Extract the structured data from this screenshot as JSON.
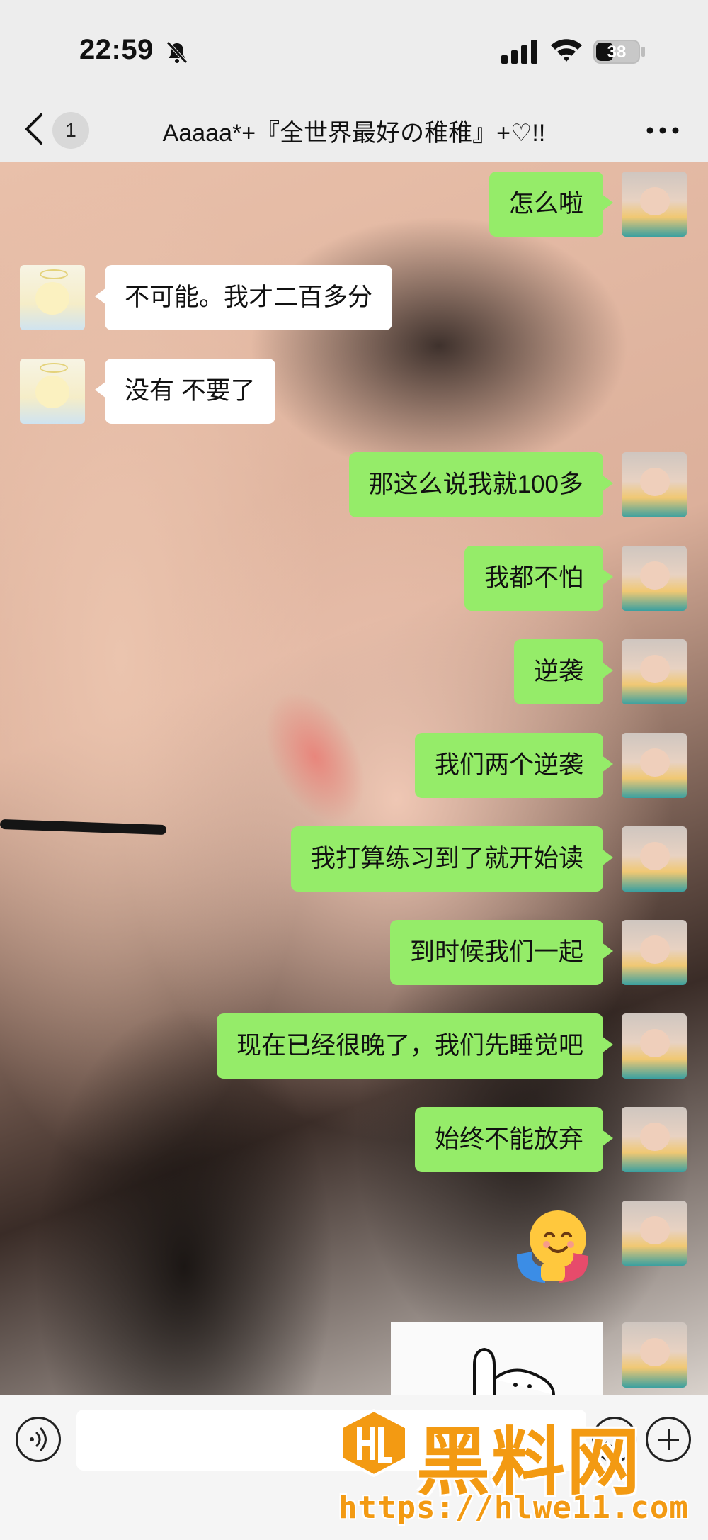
{
  "status_bar": {
    "time": "22:59",
    "battery": "38",
    "battery_level": 0.38
  },
  "nav": {
    "unread_count": "1",
    "title": "Aaaaa*+『全世界最好の稚稚』+♡!!"
  },
  "messages": [
    {
      "side": "right",
      "text": "怎么啦"
    },
    {
      "side": "left",
      "text": "不可能。我才二百多分"
    },
    {
      "side": "left",
      "text": "没有 不要了"
    },
    {
      "side": "right",
      "text": "那这么说我就100多"
    },
    {
      "side": "right",
      "text": "我都不怕"
    },
    {
      "side": "right",
      "text": "逆袭"
    },
    {
      "side": "right",
      "text": "我们两个逆袭"
    },
    {
      "side": "right",
      "text": "我打算练习到了就开始读"
    },
    {
      "side": "right",
      "text": "到时候我们一起"
    },
    {
      "side": "right",
      "text": "现在已经很晚了，我们先睡觉吧"
    },
    {
      "side": "right",
      "text": "始终不能放弃"
    },
    {
      "side": "right",
      "type": "sticker",
      "icon": "hug-emoji"
    },
    {
      "side": "right",
      "type": "image"
    }
  ],
  "input_bar": {
    "placeholder": ""
  },
  "watermark": {
    "title": "黑料网",
    "url": "https://hlwe11.com"
  },
  "colors": {
    "outgoing_bubble": "#95ec69",
    "incoming_bubble": "#ffffff",
    "watermark": "#f39a12"
  }
}
